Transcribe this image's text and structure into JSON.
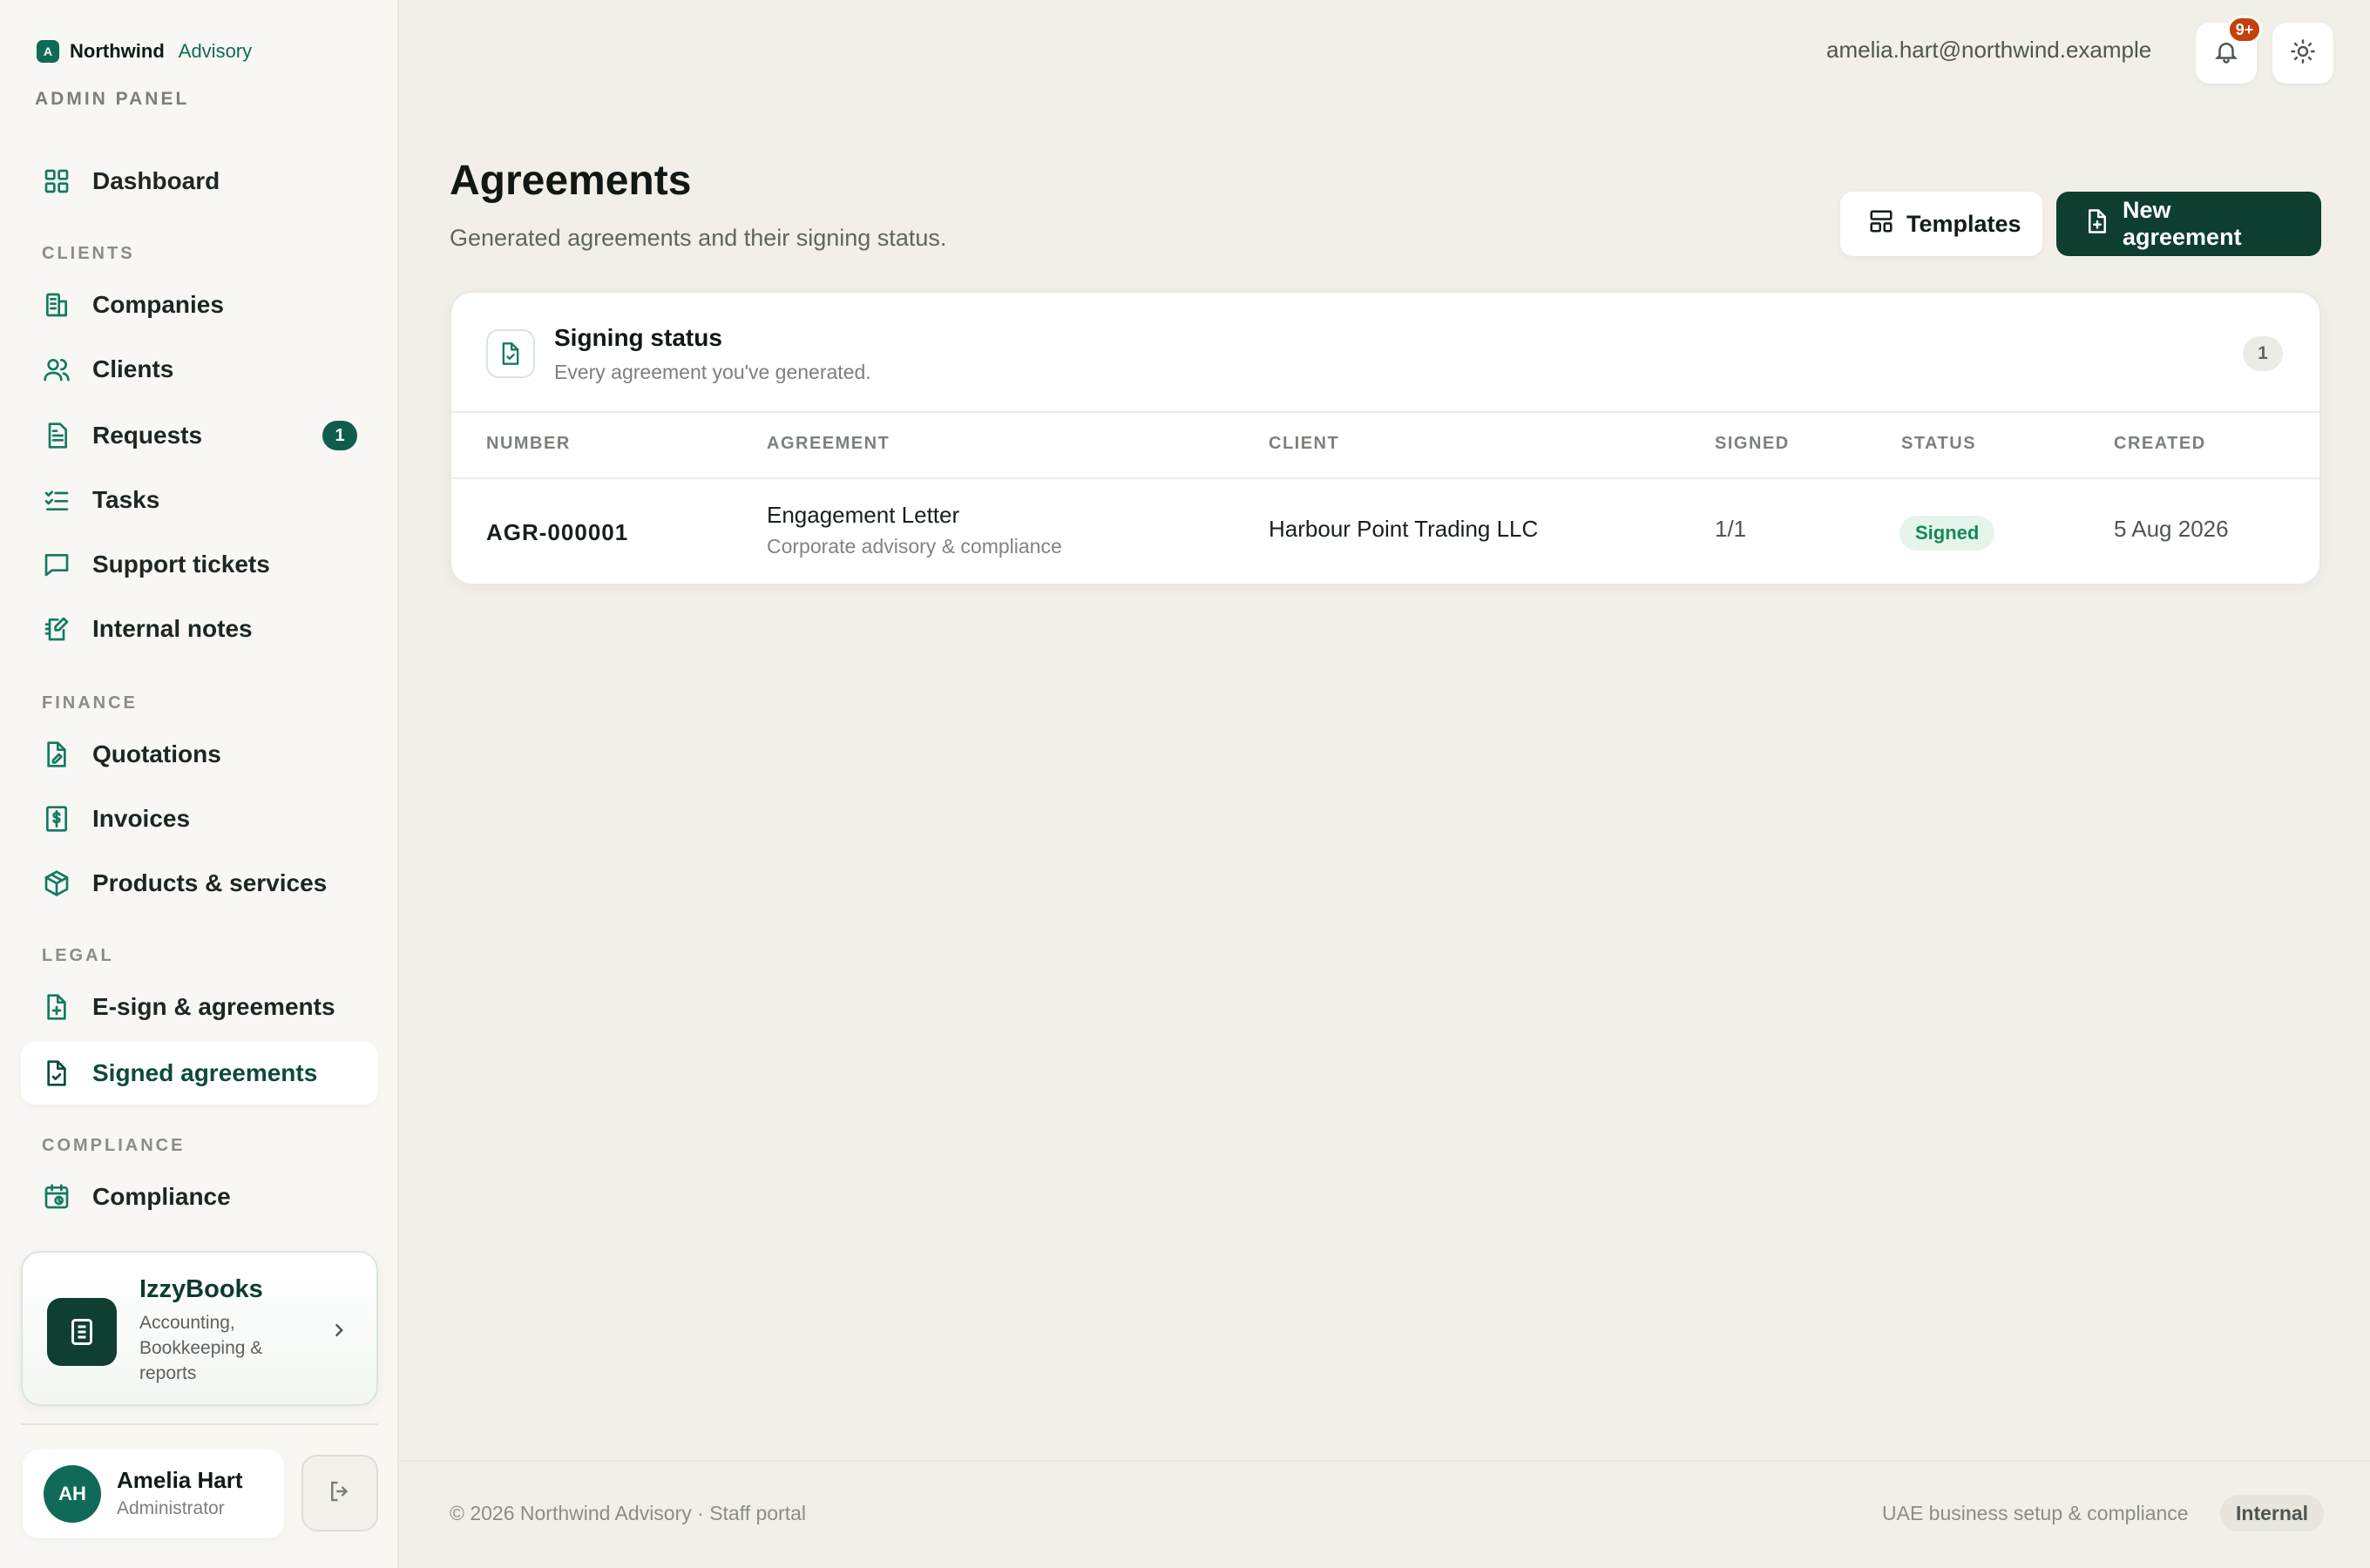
{
  "brand": {
    "mark": "A",
    "name": "Northwind",
    "sub": "Advisory",
    "panel_label": "ADMIN PANEL"
  },
  "sidebar": {
    "dashboard": "Dashboard",
    "sections": {
      "clients": "CLIENTS",
      "finance": "FINANCE",
      "legal": "LEGAL",
      "compliance": "COMPLIANCE"
    },
    "items": {
      "companies": "Companies",
      "clients": "Clients",
      "requests": "Requests",
      "requests_count": "1",
      "tasks": "Tasks",
      "support": "Support tickets",
      "notes": "Internal notes",
      "quotations": "Quotations",
      "invoices": "Invoices",
      "products": "Products & services",
      "esign": "E-sign & agreements",
      "signed": "Signed agreements",
      "compliance": "Compliance"
    },
    "promo": {
      "title": "IzzyBooks",
      "desc": "Accounting, Bookkeeping & reports"
    },
    "user": {
      "initials": "AH",
      "name": "Amelia Hart",
      "role": "Administrator"
    }
  },
  "header": {
    "email": "amelia.hart@northwind.example",
    "notif_count": "9+"
  },
  "main": {
    "title": "Agreements",
    "subtitle": "Generated agreements and their signing status.",
    "templates_label": "Templates",
    "new_label": "New agreement"
  },
  "card": {
    "title": "Signing status",
    "subtitle": "Every agreement you've generated.",
    "count": "1",
    "columns": [
      "NUMBER",
      "AGREEMENT",
      "CLIENT",
      "SIGNED",
      "STATUS",
      "CREATED"
    ],
    "rows": [
      {
        "number": "AGR-000001",
        "agreement": "Engagement Letter",
        "agreement_sub": "Corporate advisory & compliance",
        "client": "Harbour Point Trading LLC",
        "signed": "1/1",
        "status": "Signed",
        "created": "5 Aug 2026"
      }
    ]
  },
  "footer": {
    "copyright": "© 2026 Northwind Advisory · Staff portal",
    "tagline": "UAE business setup & compliance",
    "tag": "Internal"
  },
  "colors": {
    "accent": "#0f6b58",
    "dark": "#0e3d31",
    "status_signed": "#138a55",
    "badge": "#c2410c"
  }
}
